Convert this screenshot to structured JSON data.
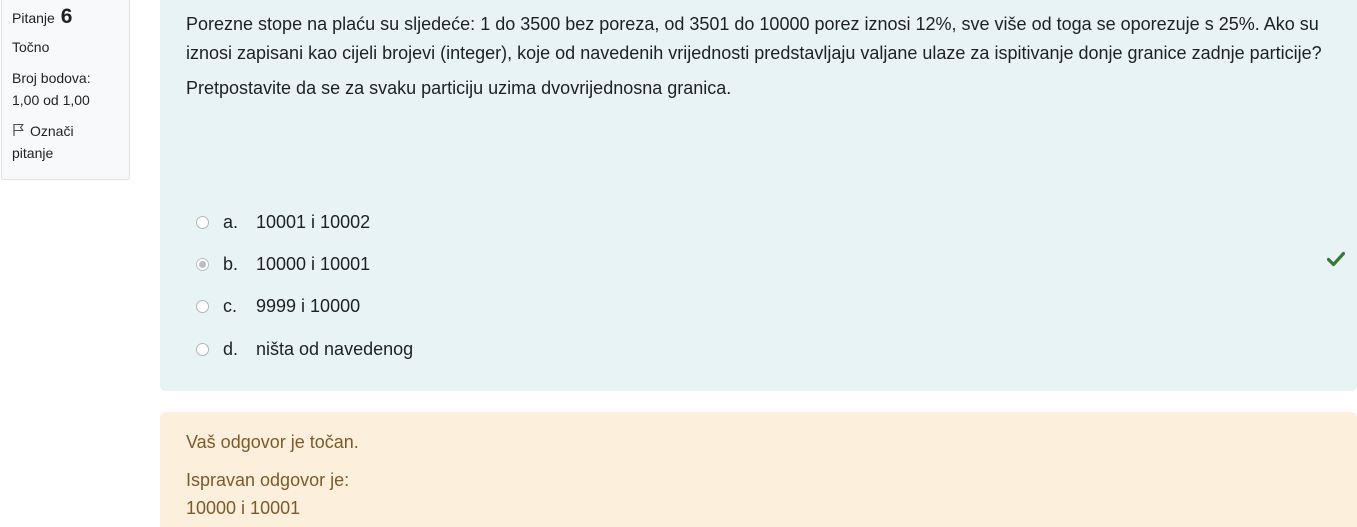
{
  "info": {
    "question_label": "Pitanje",
    "question_number": "6",
    "state": "Točno",
    "grade_label": "Broj bodova:",
    "grade_value": "1,00 od 1,00",
    "flag_label_line1": "Označi",
    "flag_label_line2": "pitanje"
  },
  "question": {
    "text_p1": "Porezne stope na plaću su sljedeće: 1 do 3500 bez poreza, od 3501 do 10000 porez iznosi 12%, sve više od toga se oporezuje s 25%. Ako su iznosi zapisani kao cijeli brojevi (integer), koje od navedenih vrijednosti predstavljaju valjane ulaze za ispitivanje donje granice zadnje particije?",
    "text_p2": "Pretpostavite da se za svaku particiju uzima dvovrijednosna granica.",
    "answers": [
      {
        "letter": "a.",
        "text": "10001 i 10002",
        "selected": false
      },
      {
        "letter": "b.",
        "text": "10000 i 10001",
        "selected": true
      },
      {
        "letter": "c.",
        "text": "9999 i 10000",
        "selected": false
      },
      {
        "letter": "d.",
        "text": "ništa od navedenog",
        "selected": false
      }
    ],
    "correct_icon": "check-icon",
    "correct_color": "#357a32"
  },
  "feedback": {
    "result": "Vaš odgovor je točan.",
    "correct_answer_label": "Ispravan odgovor je:",
    "correct_answer_value": "10000 i 10001",
    "background": "#fcefdc",
    "text_color": "#7d5a29"
  },
  "colors": {
    "formulation_background": "#e7f3f5",
    "info_background": "#f8f9fa"
  }
}
